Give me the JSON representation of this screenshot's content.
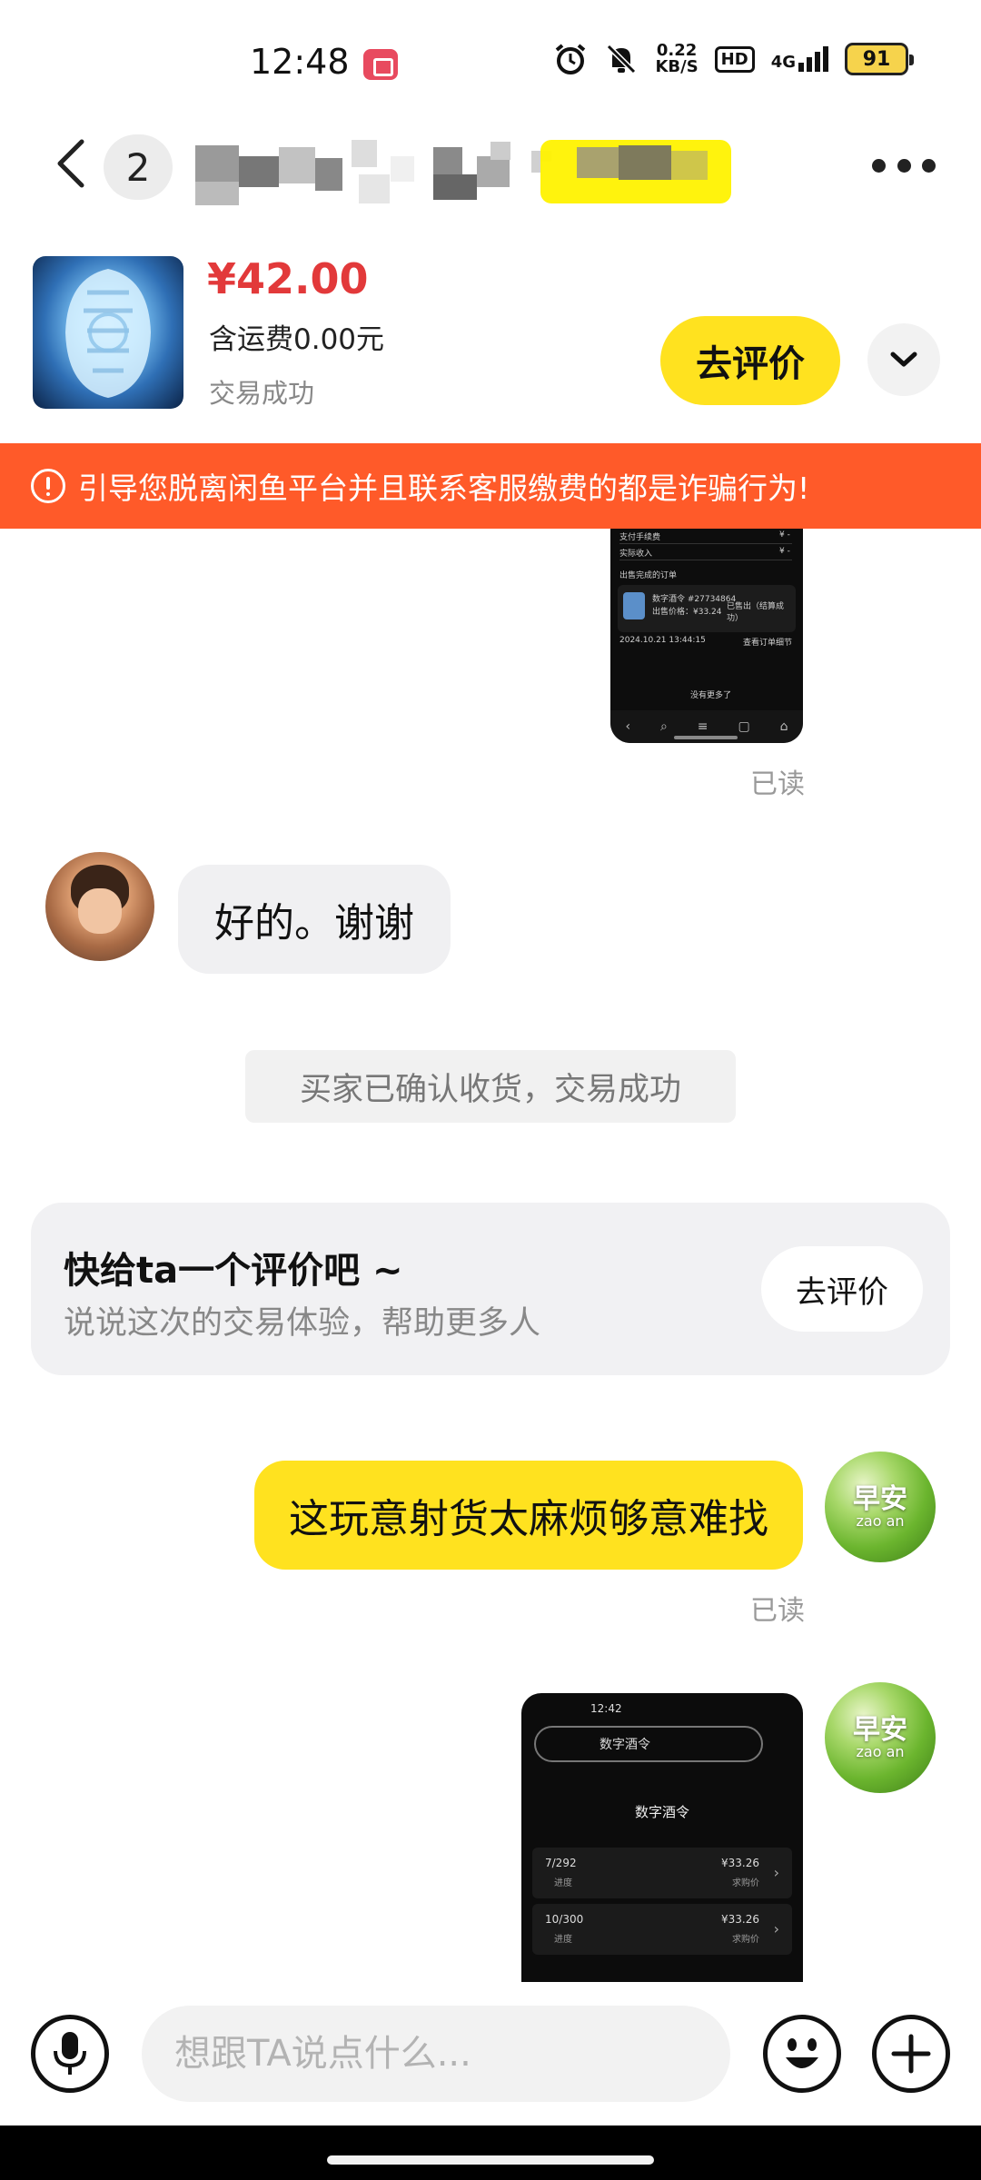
{
  "status_bar": {
    "time": "12:48",
    "net_speed_value": "0.22",
    "net_speed_unit": "KB/S",
    "hd": "HD",
    "network": "4G",
    "battery": "91"
  },
  "header": {
    "unread_count": "2"
  },
  "product": {
    "price": "¥42.00",
    "shipping": "含运费0.00元",
    "status": "交易成功",
    "review_button": "去评价"
  },
  "warning": {
    "text": "引导您脱离闲鱼平台并且联系客服缴费的都是诈骗行为!"
  },
  "messages": {
    "read_label_1": "已读",
    "incoming_1": "好的。谢谢",
    "system_1": "买家已确认收货，交易成功",
    "review_card": {
      "title": "快给ta一个评价吧 ~",
      "subtitle": "说说这次的交易体验，帮助更多人",
      "button": "去评价"
    },
    "outgoing_1": "这玩意射货太麻烦够意难找",
    "read_label_2": "已读"
  },
  "shot1": {
    "row1": "支付手续费",
    "row2": "实际收入",
    "section": "出售完成的订单",
    "order_title": "数字酒令 #27734864",
    "order_price": "出售价格：¥33.24",
    "order_status": "已售出（结算成功）",
    "order_time": "2024.10.21 13:44:15",
    "order_link": "查看订单细节",
    "no_more": "没有更多了"
  },
  "shot2": {
    "time": "12:42",
    "search_text": "数字酒令",
    "title": "数字酒令",
    "rows": [
      {
        "left": "7/292",
        "left_sub": "进度",
        "right": "¥33.26",
        "right_sub": "求购价"
      },
      {
        "left": "10/300",
        "left_sub": "进度",
        "right": "¥33.26",
        "right_sub": "求购价"
      }
    ]
  },
  "avatars": {
    "leaf_big": "早安",
    "leaf_small": "zao an"
  },
  "input": {
    "placeholder": "想跟TA说点什么..."
  }
}
